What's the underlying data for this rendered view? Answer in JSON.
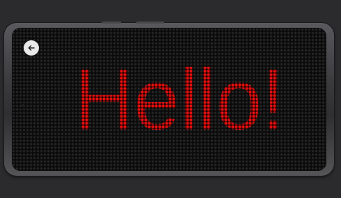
{
  "display": {
    "message": "Hello!",
    "text_color": "#e01010",
    "background_color": "#0b0b0b"
  },
  "controls": {
    "back_icon": "arrow-left-icon"
  }
}
